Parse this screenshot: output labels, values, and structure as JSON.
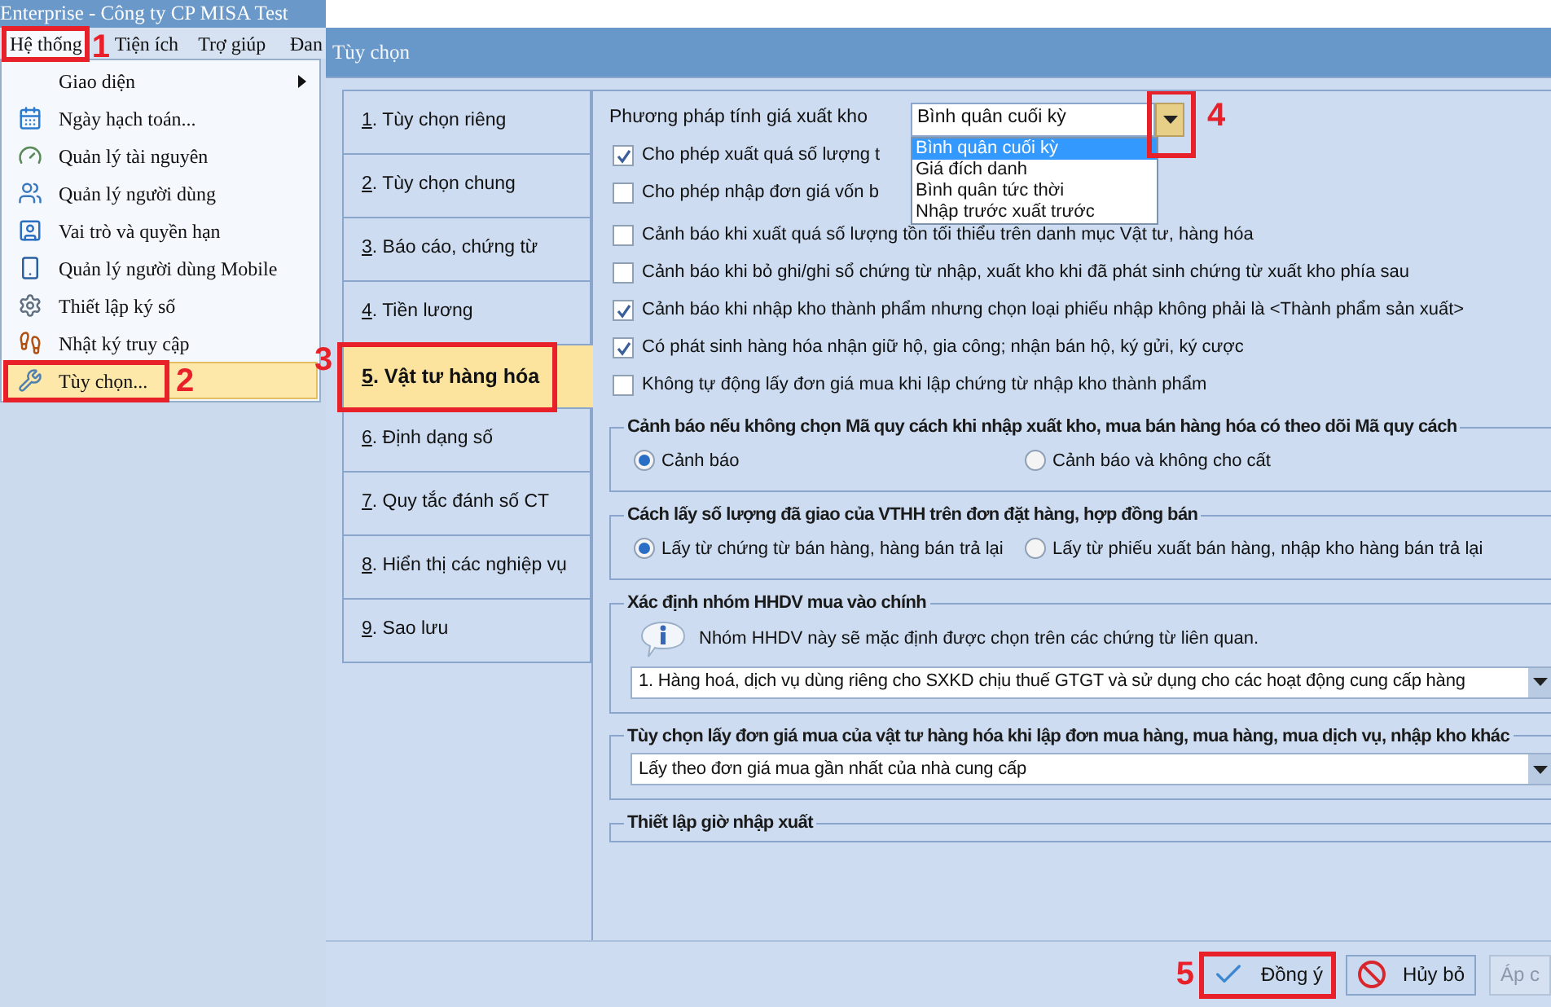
{
  "app_title": "Enterprise - Công ty CP MISA Test",
  "menu_bar": [
    {
      "label": "Hệ thống",
      "selected": true,
      "callout": "1"
    },
    {
      "label": "Tiện ích",
      "selected": false
    },
    {
      "label": "Trợ giúp",
      "selected": false
    },
    {
      "label": "Đan",
      "selected": false
    }
  ],
  "menu": [
    {
      "label": "Giao diện",
      "submenu": true,
      "selected": false
    },
    {
      "label": "Ngày hạch toán...",
      "submenu": false,
      "selected": false
    },
    {
      "label": "Quản lý tài nguyên",
      "submenu": false,
      "selected": false
    },
    {
      "label": "Quản lý người dùng",
      "submenu": false,
      "selected": false
    },
    {
      "label": "Vai trò và quyền hạn",
      "submenu": false,
      "selected": false
    },
    {
      "label": "Quản lý người dùng Mobile",
      "submenu": false,
      "selected": false
    },
    {
      "label": "Thiết lập ký số",
      "submenu": false,
      "selected": false
    },
    {
      "label": "Nhật ký truy cập",
      "submenu": false,
      "selected": false
    },
    {
      "label": "Tùy chọn...",
      "submenu": false,
      "selected": true,
      "callout": "2"
    }
  ],
  "dialog": {
    "title": "Tùy chọn",
    "nav": [
      {
        "label": "1. Tùy chọn riêng",
        "selected": false
      },
      {
        "label": "2. Tùy chọn chung",
        "selected": false
      },
      {
        "label": "3. Báo cáo, chứng từ",
        "selected": false
      },
      {
        "label": "4. Tiền lương",
        "selected": false
      },
      {
        "label": "5. Vật tư hàng hóa",
        "selected": true,
        "callout": "3"
      },
      {
        "label": "6. Định dạng số",
        "selected": false
      },
      {
        "label": "7. Quy tắc đánh số CT",
        "selected": false
      },
      {
        "label": "8. Hiển thị các nghiệp vụ",
        "selected": false
      },
      {
        "label": "9. Sao lưu",
        "selected": false
      }
    ],
    "costing": {
      "label": "Phương pháp tính giá xuất kho",
      "value": "Bình quân cuối kỳ",
      "expanded": true,
      "callout": "4",
      "options": [
        {
          "label": "Bình quân cuối kỳ",
          "selected": true
        },
        {
          "label": "Giá đích danh",
          "selected": false
        },
        {
          "label": "Bình quân tức thời",
          "selected": false
        },
        {
          "label": "Nhập trước xuất trước",
          "selected": false
        }
      ]
    },
    "checkboxes": [
      {
        "label": "Cho phép xuất quá số lượng t",
        "checked": true
      },
      {
        "label": "Cho phép nhập đơn giá vốn b",
        "checked": false
      },
      {
        "label": "Cảnh báo khi xuất quá số lượng tồn tối thiểu trên danh mục Vật tư, hàng hóa",
        "checked": false
      },
      {
        "label": "Cảnh báo khi bỏ ghi/ghi sổ chứng từ nhập, xuất kho khi đã phát sinh chứng từ xuất kho phía sau",
        "checked": false
      },
      {
        "label": "Cảnh báo khi nhập kho thành phẩm nhưng chọn loại phiếu nhập không phải là <Thành phẩm sản xuất>",
        "checked": true
      },
      {
        "label": "Có phát sinh hàng hóa nhận giữ hộ, gia công; nhận bán hộ, ký gửi, ký cược",
        "checked": true
      },
      {
        "label": "Không tự động lấy đơn giá mua khi lập chứng từ nhập kho thành phẩm",
        "checked": false
      }
    ],
    "groups": [
      {
        "kind": "radios",
        "title": "Cảnh báo nếu không chọn Mã quy cách khi nhập xuất kho, mua bán hàng hóa có theo dõi Mã quy cách",
        "options": [
          {
            "label": "Cảnh báo",
            "selected": true
          },
          {
            "label": "Cảnh báo và không cho cất",
            "selected": false
          }
        ]
      },
      {
        "kind": "radios",
        "title": "Cách lấy số lượng đã giao của VTHH trên đơn đặt hàng, hợp đồng bán",
        "options": [
          {
            "label": "Lấy từ chứng từ bán hàng, hàng bán trả lại",
            "selected": true
          },
          {
            "label": "Lấy từ phiếu xuất bán hàng, nhập kho hàng bán trả lại",
            "selected": false
          }
        ]
      },
      {
        "kind": "info-combo",
        "title": "Xác định nhóm HHDV mua vào chính",
        "note": "Nhóm HHDV này sẽ mặc định được chọn trên các chứng từ liên quan.",
        "value": "1. Hàng hoá, dịch vụ dùng riêng cho SXKD chịu thuế GTGT và sử dụng cho các hoạt động cung cấp hàng"
      },
      {
        "kind": "combo",
        "title": "Tùy chọn lấy đơn giá mua của vật tư hàng hóa khi lập đơn mua hàng, mua hàng, mua dịch vụ, nhập kho khác",
        "value": "Lấy theo đơn giá mua gần nhất của nhà cung cấp"
      },
      {
        "kind": "title-only",
        "title": "Thiết lập giờ nhập xuất"
      }
    ],
    "buttons": [
      {
        "label": "Đồng ý",
        "disabled": false,
        "callout": "5"
      },
      {
        "label": "Hủy bỏ",
        "disabled": false
      },
      {
        "label": "Áp c",
        "disabled": true
      }
    ]
  }
}
